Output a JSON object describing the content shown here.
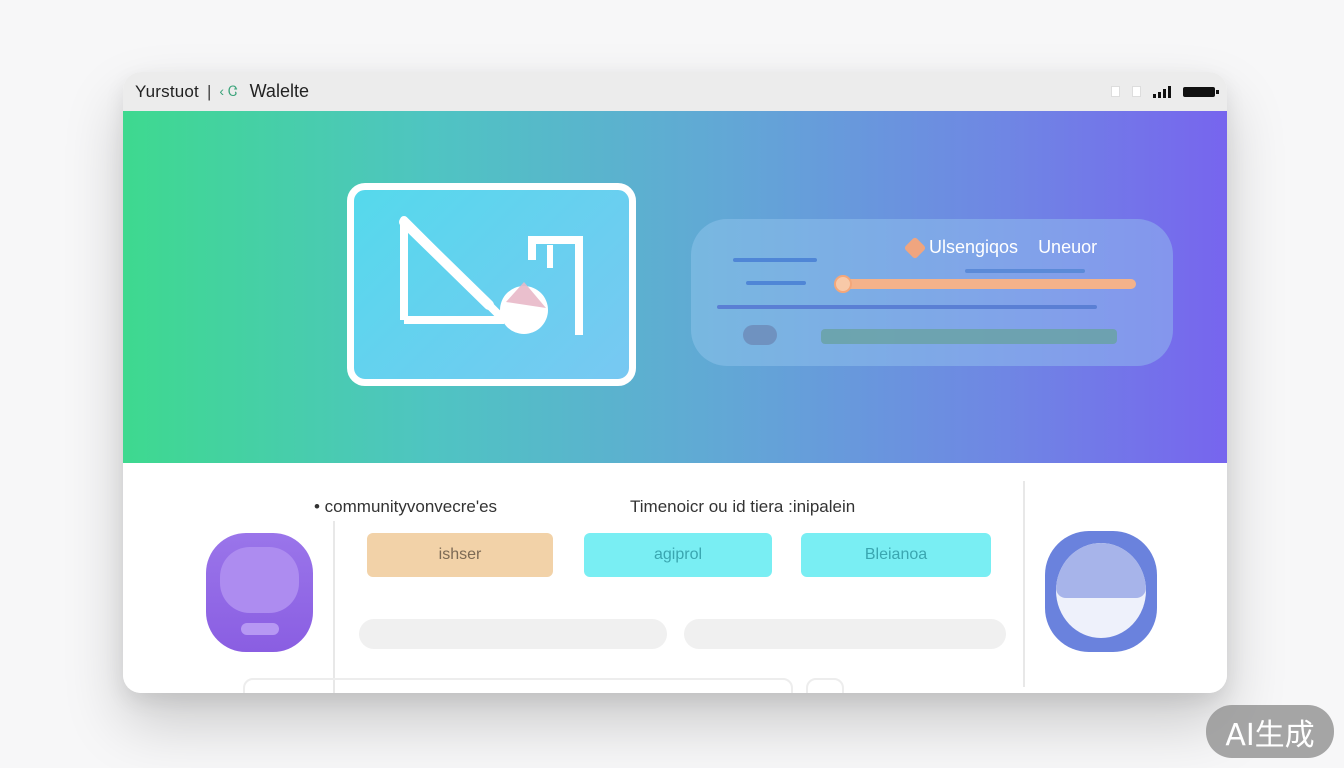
{
  "titlebar": {
    "app_name": "Yurstuot",
    "separator": "|",
    "sub_label": "‹ Ꮳ",
    "window_title": "Walelte"
  },
  "hero": {
    "panel_title": "Ulsengiqos",
    "panel_subtitle": "Uneuor",
    "slider_value": 0.02
  },
  "lower": {
    "heading_left": "• communityvonvecre'es",
    "heading_right": "Timenoicr ou id tiera :inipalein",
    "buttons": [
      {
        "label": "ishser"
      },
      {
        "label": "agiprol"
      },
      {
        "label": "Bleianoa"
      }
    ]
  },
  "watermark": {
    "text": "AI生成"
  },
  "colors": {
    "hero_start": "#3ed98f",
    "hero_end": "#7765ee",
    "button_orange": "#f2d2a8",
    "button_cyan": "#79eef3",
    "avatar_purple": "#8a5ee2",
    "avatar_blue": "#6a82dd"
  }
}
